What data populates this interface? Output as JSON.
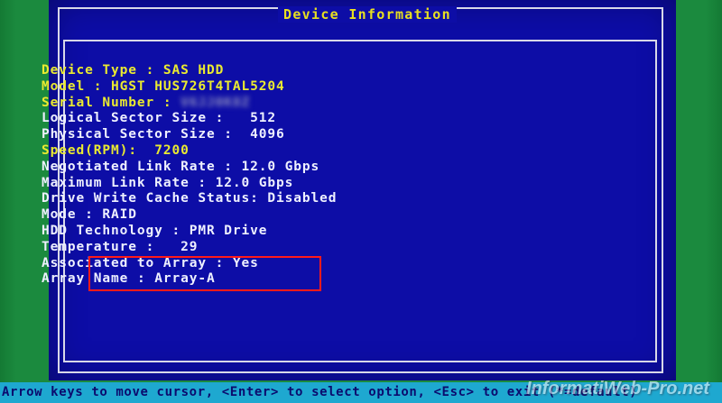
{
  "dialog": {
    "title": "Device Information"
  },
  "fields": [
    {
      "label": "Device Type",
      "sep": " : ",
      "value": "SAS HDD"
    },
    {
      "label": "Model",
      "sep": " : ",
      "value": "HGST HUS726T4TAL5204"
    },
    {
      "label": "Serial Number",
      "sep": " : ",
      "value": "V6JJ0K8Z"
    },
    {
      "label": "Logical Sector Size",
      "sep": " :   ",
      "value": "512"
    },
    {
      "label": "Physical Sector Size",
      "sep": " :  ",
      "value": "4096"
    },
    {
      "label": "Speed(RPM)",
      "sep": ":  ",
      "value": "7200"
    },
    {
      "label": "Negotiated Link Rate",
      "sep": " : ",
      "value": "12.0 Gbps"
    },
    {
      "label": "Maximum Link Rate",
      "sep": " : ",
      "value": "12.0 Gbps"
    },
    {
      "label": "Drive Write Cache Status",
      "sep": ": ",
      "value": "Disabled"
    },
    {
      "label": "Mode",
      "sep": " : ",
      "value": "RAID"
    },
    {
      "label": "HDD Technology",
      "sep": " : ",
      "value": "PMR Drive"
    },
    {
      "label": "Temperature",
      "sep": " :   ",
      "value": "29"
    },
    {
      "label": "Associated to Array",
      "sep": " : ",
      "value": "Yes"
    },
    {
      "label": "Array Name",
      "sep": " : ",
      "value": "Array-A"
    }
  ],
  "statusbar": {
    "text": "Arrow keys to move cursor, <Enter> to select option, <Esc> to exit (*=default)"
  },
  "watermark": {
    "text": "InformatiWeb-Pro.net"
  },
  "colors": {
    "background": "#0d0da6",
    "text_yellow": "#eaea30",
    "text_white": "#eef0ff",
    "highlight": "#ff1a1a",
    "statusbar": "#1ea8d0"
  }
}
